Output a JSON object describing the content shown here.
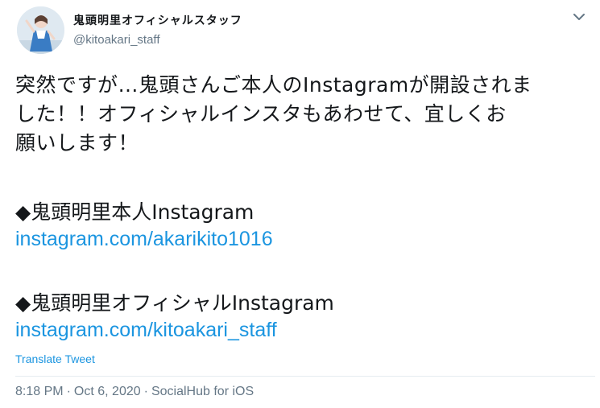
{
  "author": {
    "display_name": "鬼頭明里オフィシャルスタッフ",
    "handle": "@kitoakari_staff"
  },
  "tweet": {
    "body_lines": [
      "突然ですが…鬼頭さんご本人のInstagramが開設されま",
      "した！！オフィシャルインスタもあわせて、宜しくお",
      "願いします！"
    ],
    "section1_label": "◆鬼頭明里本人Instagram",
    "section1_link": "instagram.com/akarikito1016",
    "section2_label": "◆鬼頭明里オフィシャルInstagram",
    "section2_link": "instagram.com/kitoakari_staff",
    "translate_label": "Translate Tweet"
  },
  "meta": {
    "time": "8:18 PM",
    "separator": "·",
    "date": "Oct 6, 2020",
    "source": "SocialHub for iOS"
  },
  "icons": {
    "caret": "chevron-down-icon",
    "avatar": "avatar-photo"
  },
  "colors": {
    "link": "#1b95e0",
    "muted": "#657786",
    "text": "#14171a"
  }
}
